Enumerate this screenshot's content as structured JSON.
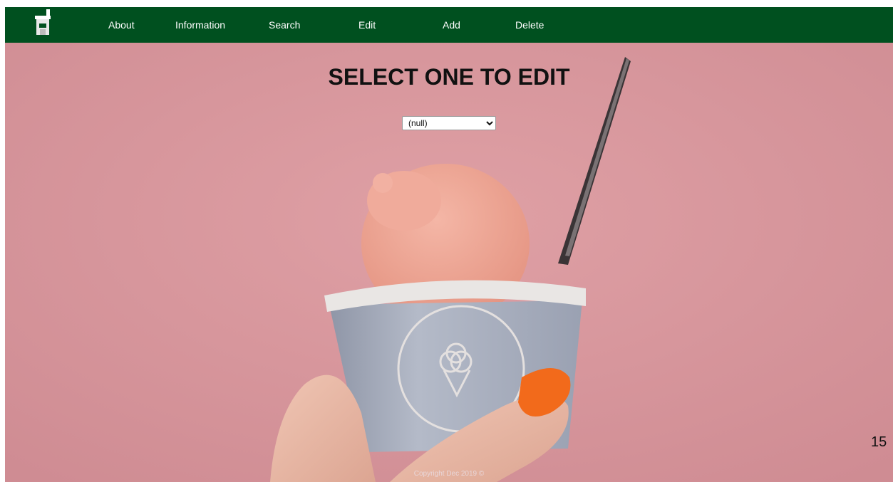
{
  "nav": {
    "logo_icon": "ice-cream-shop-icon",
    "items": [
      {
        "label": "About"
      },
      {
        "label": "Information"
      },
      {
        "label": "Search"
      },
      {
        "label": "Edit"
      },
      {
        "label": "Add"
      },
      {
        "label": "Delete"
      }
    ],
    "background_color": "#00501f"
  },
  "main": {
    "title": "SELECT ONE TO EDIT",
    "select": {
      "selected_value": "(null)"
    },
    "hero_image": "ice-cream-cup-photo",
    "background_color": "#d8949b"
  },
  "footer": {
    "copyright": "Copyright Dec 2019 ©"
  },
  "page_number": "15"
}
